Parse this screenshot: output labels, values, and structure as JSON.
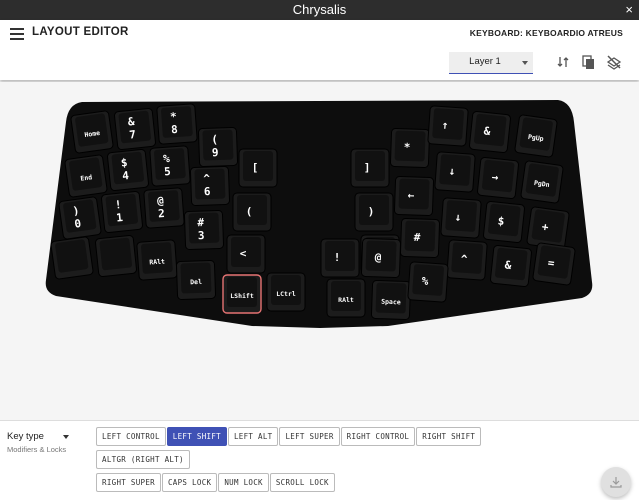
{
  "window": {
    "title": "Chrysalis",
    "close": "×"
  },
  "appbar": {
    "title": "LAYOUT EDITOR",
    "keyboard": "KEYBOARD: KEYBOARDIO ATREUS"
  },
  "layer": {
    "selected": "Layer 1"
  },
  "toolbar": {
    "icons": [
      "swap-vertical-icon",
      "copy-layer-icon",
      "hide-layer-icon"
    ]
  },
  "colors": {
    "accent": "#3f51b5",
    "key": "#1c1c1c",
    "key_top": "#111111",
    "key_text": "#ffffff",
    "highlight": "#e57373",
    "case": "#0d0d0d"
  },
  "keyboard": {
    "selected_key": "LShift",
    "keys": [
      {
        "label": "Home"
      },
      {
        "label": "&\n7"
      },
      {
        "label": "*\n8"
      },
      {
        "label": "(\n9"
      },
      {
        "label": "["
      },
      {
        "label": "]"
      },
      {
        "label": "*"
      },
      {
        "label": "↑"
      },
      {
        "label": "&"
      },
      {
        "label": "PgUp"
      },
      {
        "label": "End"
      },
      {
        "label": "$\n4"
      },
      {
        "label": "%\n5"
      },
      {
        "label": "^\n6"
      },
      {
        "label": "("
      },
      {
        "label": ")"
      },
      {
        "label": "←"
      },
      {
        "label": "↓"
      },
      {
        "label": "→"
      },
      {
        "label": "PgDn"
      },
      {
        "label": ")\n0"
      },
      {
        "label": "!\n1"
      },
      {
        "label": "@\n2"
      },
      {
        "label": "#\n3"
      },
      {
        "label": "<"
      },
      {
        "label": ">"
      },
      {
        "label": "#"
      },
      {
        "label": "↓"
      },
      {
        "label": "$"
      },
      {
        "label": "+"
      },
      {
        "label": ""
      },
      {
        "label": ""
      },
      {
        "label": "RAlt"
      },
      {
        "label": "Del"
      },
      {
        "label": "LShift"
      },
      {
        "label": "LCtrl"
      },
      {
        "label": "!"
      },
      {
        "label": "@"
      },
      {
        "label": "^"
      },
      {
        "label": "&"
      },
      {
        "label": "="
      },
      {
        "label": "RAlt"
      },
      {
        "label": "Space"
      },
      {
        "label": "%"
      }
    ]
  },
  "keytype": {
    "label": "Key type",
    "sub": "Modifiers & Locks"
  },
  "modifiers": [
    {
      "label": "LEFT CONTROL",
      "selected": false
    },
    {
      "label": "LEFT SHIFT",
      "selected": true
    },
    {
      "label": "LEFT ALT",
      "selected": false
    },
    {
      "label": "LEFT SUPER",
      "selected": false
    },
    {
      "label": "RIGHT CONTROL",
      "selected": false
    },
    {
      "label": "RIGHT SHIFT",
      "selected": false
    },
    {
      "label": "ALTGR (RIGHT ALT)",
      "selected": false
    },
    {
      "label": "RIGHT SUPER",
      "selected": false
    },
    {
      "label": "CAPS LOCK",
      "selected": false
    },
    {
      "label": "NUM LOCK",
      "selected": false
    },
    {
      "label": "SCROLL LOCK",
      "selected": false
    }
  ],
  "fab": {
    "icon": "download-icon"
  }
}
